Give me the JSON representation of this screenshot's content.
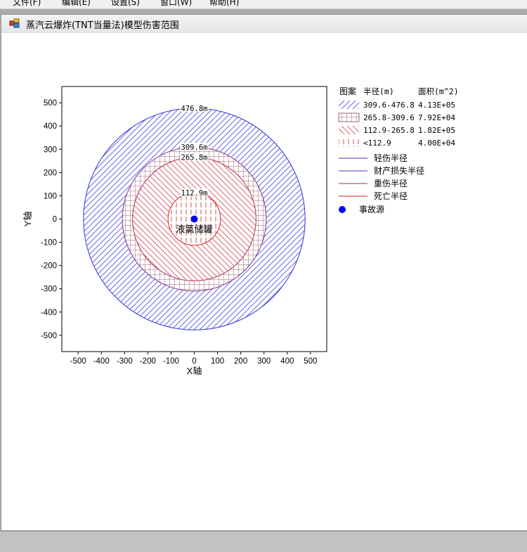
{
  "menubar": {
    "items": [
      "文件(F)",
      "编辑(E)",
      "设置(S)",
      "窗口(W)",
      "帮助(H)"
    ]
  },
  "window": {
    "title": "蒸汽云爆炸(TNT当量法)模型伤害范围"
  },
  "chart_data": {
    "type": "scatter",
    "xlabel": "X轴",
    "ylabel": "Y轴",
    "xlim": [
      -570,
      570
    ],
    "ylim": [
      -570,
      570
    ],
    "xticks": [
      -500,
      -400,
      -300,
      -200,
      -100,
      0,
      100,
      200,
      300,
      400,
      500
    ],
    "yticks": [
      500,
      400,
      300,
      200,
      100,
      0,
      -100,
      -200,
      -300,
      -400,
      -500
    ],
    "circles": [
      {
        "radius": 476.8,
        "label": "476.8m",
        "color": "#3333dd",
        "hatch": "diagonal-up",
        "hatch_color": "#6666ee"
      },
      {
        "radius": 309.6,
        "label": "309.6m",
        "color": "#7a3a8a",
        "hatch": "grid",
        "hatch_color": "#a06070"
      },
      {
        "radius": 265.8,
        "label": "265.8m",
        "color": "#aa3355",
        "hatch": "diagonal-down",
        "hatch_color": "#dd6677"
      },
      {
        "radius": 112.9,
        "label": "112.9m",
        "color": "#dd2222",
        "hatch": "vertical",
        "hatch_color": "#cc5555"
      }
    ],
    "source": {
      "x": 0,
      "y": 0,
      "label": "液氯储罐",
      "color": "#0000ee"
    },
    "legend": {
      "header": [
        "图案",
        "半径(m)",
        "面积(m^2)"
      ],
      "rows": [
        {
          "range": "309.6-476.8",
          "area": "4.13E+05"
        },
        {
          "range": "265.8-309.6",
          "area": "7.92E+04"
        },
        {
          "range": "112.9-265.8",
          "area": "1.82E+05"
        },
        {
          "range": "<112.9",
          "area": "4.00E+04"
        }
      ],
      "lines": [
        {
          "label": "轻伤半径",
          "color": "#3333dd"
        },
        {
          "label": "财产损失半径",
          "color": "#6633aa"
        },
        {
          "label": "重伤半径",
          "color": "#993355"
        },
        {
          "label": "死亡半径",
          "color": "#dd2222"
        }
      ],
      "source_label": "事故源"
    }
  }
}
